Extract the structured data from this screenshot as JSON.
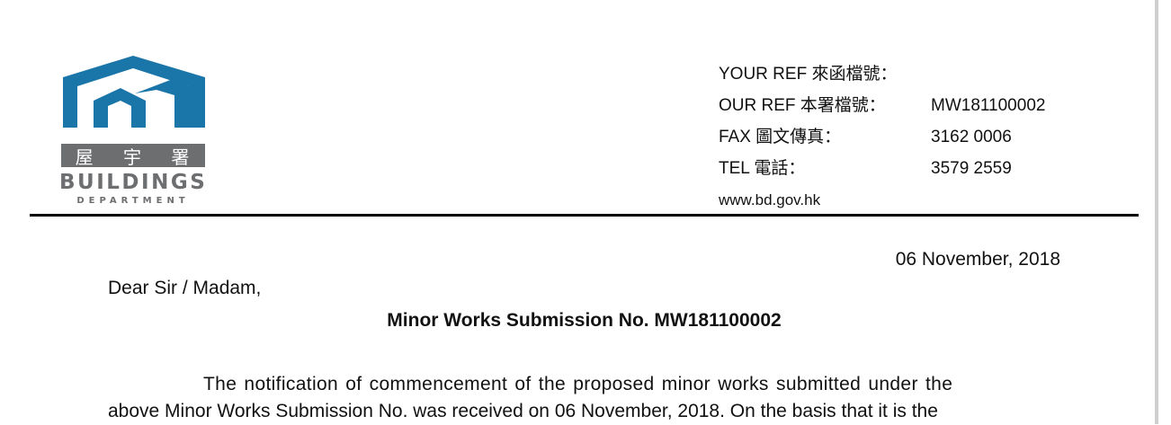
{
  "department": {
    "name_chinese": "屋宇署",
    "name_chinese_chars": [
      "屋",
      "宇",
      "署"
    ],
    "name_line1": "BUILDINGS",
    "name_line2": "DEPARTMENT",
    "logo_blue": "#1a75a8",
    "logo_grey": "#6d6e70"
  },
  "references": [
    {
      "label": "YOUR REF 來函檔號：",
      "value": ""
    },
    {
      "label": "OUR REF 本署檔號：",
      "value": "MW181100002"
    },
    {
      "label": "FAX 圖文傳真：",
      "value": "3162 0006"
    },
    {
      "label": "TEL 電話：",
      "value": "3579 2559"
    }
  ],
  "website": "www.bd.gov.hk",
  "letter": {
    "date": "06 November, 2018",
    "salutation": "Dear Sir / Madam,",
    "subject": "Minor Works Submission No. MW181100002",
    "body_lines": [
      "The notification of commencement of the proposed minor works submitted under the",
      "above Minor Works Submission No. was received on 06 November, 2018. On the basis that it is the"
    ]
  }
}
